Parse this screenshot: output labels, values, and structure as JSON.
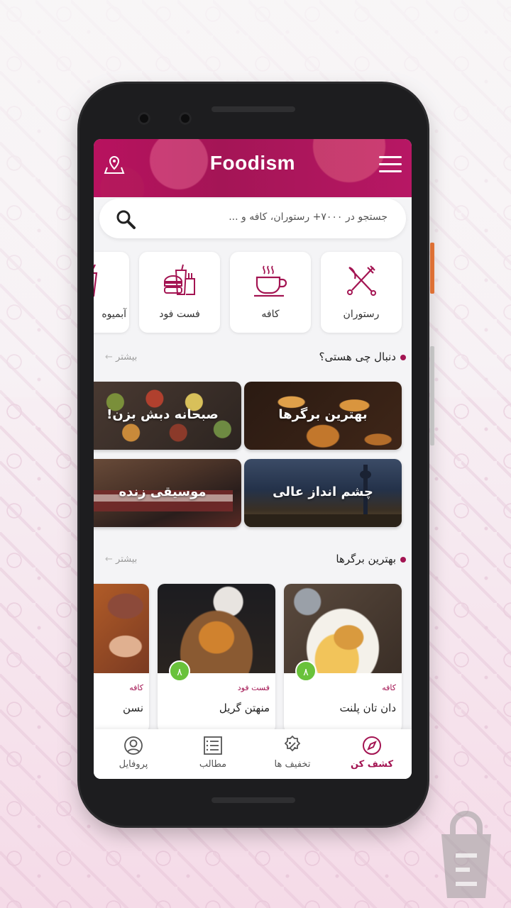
{
  "app": {
    "logo": "Foodism",
    "brand_color": "#a31452",
    "rating_color": "#69c23b"
  },
  "search": {
    "placeholder": "جستجو در ۷۰۰۰+ رستوران، کافه و ..."
  },
  "categories": [
    {
      "label": "رستوران",
      "icon": "fork-knife-icon"
    },
    {
      "label": "کافه",
      "icon": "coffee-cup-icon"
    },
    {
      "label": "فست فود",
      "icon": "fast-food-icon"
    },
    {
      "label": "آبمیوه",
      "icon": "juice-icon"
    }
  ],
  "section1": {
    "title": "دنبال چی هستی؟",
    "more": "بیشتر",
    "tiles": [
      {
        "label": "بهترین برگرها"
      },
      {
        "label": "صبحانه دبش بزن!"
      },
      {
        "label": "چشم انداز عالی"
      },
      {
        "label": "موسیقی زنده"
      }
    ]
  },
  "section2": {
    "title": "بهترین برگرها",
    "more": "بیشتر",
    "cards": [
      {
        "type": "کافه",
        "name": "دان تان پلنت",
        "rating": "۸"
      },
      {
        "type": "فست فود",
        "name": "منهتن گریل",
        "rating": "۸"
      },
      {
        "type": "کافه",
        "name": "نسن",
        "rating": ""
      }
    ]
  },
  "nav": {
    "items": [
      {
        "label": "کشف کن",
        "icon": "compass-icon",
        "active": true
      },
      {
        "label": "تخفیف ها",
        "icon": "discount-icon",
        "active": false
      },
      {
        "label": "مطالب",
        "icon": "list-icon",
        "active": false
      },
      {
        "label": "پروفایل",
        "icon": "user-icon",
        "active": false
      }
    ]
  }
}
